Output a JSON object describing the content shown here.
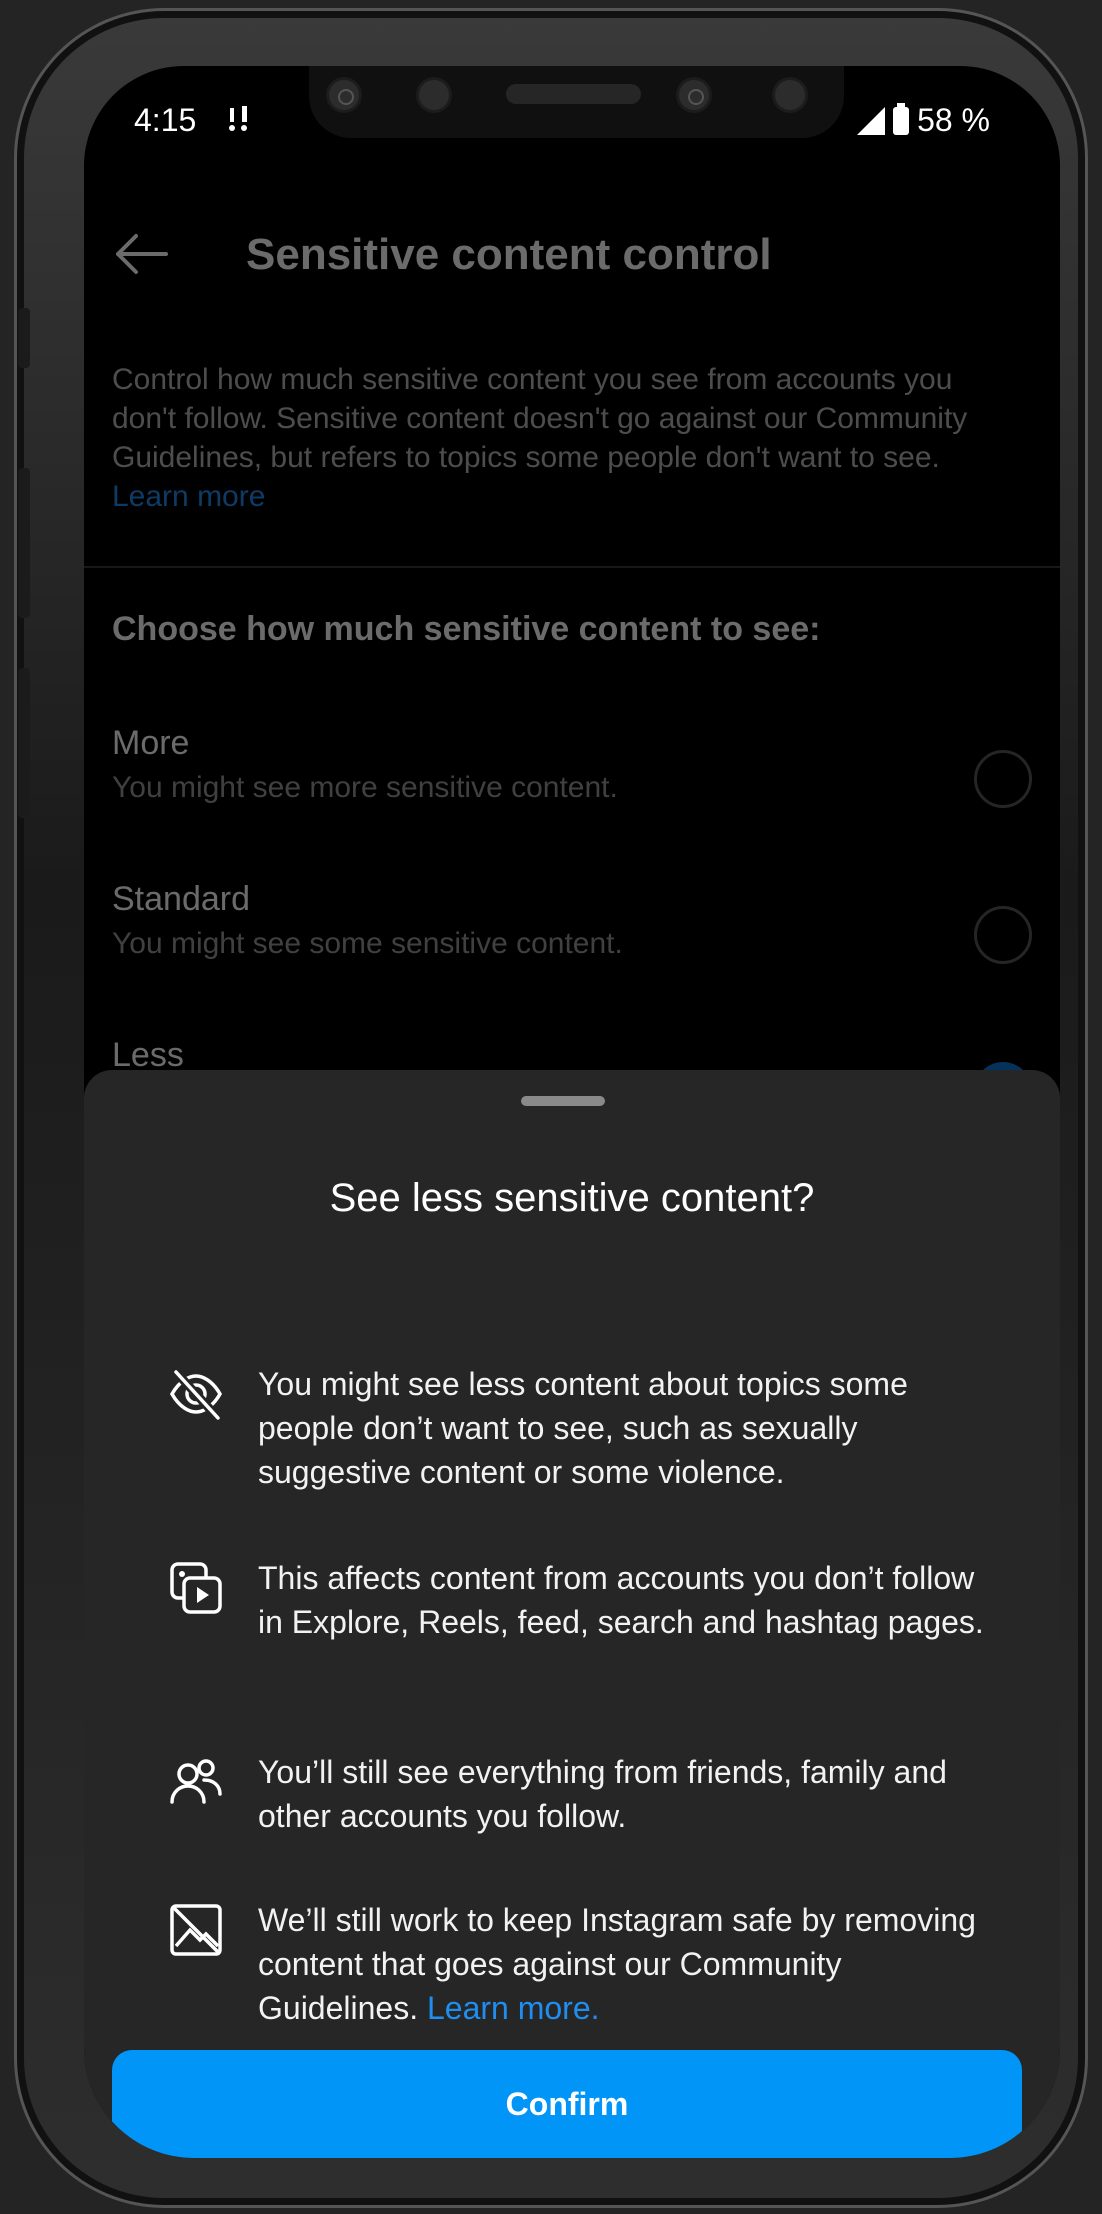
{
  "status_bar": {
    "time": "4:15",
    "notification": " ꜝ!",
    "battery": "58 %"
  },
  "header": {
    "title": "Sensitive content control"
  },
  "description": {
    "text": "Control how much sensitive content you see from accounts you don't follow. Sensitive content doesn't go against our Community Guidelines, but refers to topics some people don't want to see.",
    "link": "Learn more"
  },
  "choose_heading": "Choose how much sensitive content to see:",
  "options": [
    {
      "label": "More",
      "sub": "You might see more sensitive content.",
      "selected": false
    },
    {
      "label": "Standard",
      "sub": "You might see some sensitive content.",
      "selected": false
    },
    {
      "label": "Less",
      "sub": "",
      "selected": true
    }
  ],
  "sheet": {
    "title": "See less sensitive content?",
    "items": [
      {
        "icon": "eye-off-icon",
        "text": "You might see less content about topics some people don’t want to see, such as sexually suggestive content or some violence."
      },
      {
        "icon": "media-play-icon",
        "text": "This affects content from accounts you don’t follow in Explore, Reels, feed, search and hashtag pages."
      },
      {
        "icon": "people-icon",
        "text": "You’ll still see everything from friends, family and other accounts you follow."
      },
      {
        "icon": "image-off-icon",
        "text": "We’ll still work to keep Instagram safe by removing content that goes against our Community Guidelines.",
        "link": "Learn more."
      }
    ],
    "confirm_label": "Confirm"
  },
  "colors": {
    "accent": "#0095f6",
    "link": "#1f8ef1",
    "sheet_bg": "#262626"
  }
}
